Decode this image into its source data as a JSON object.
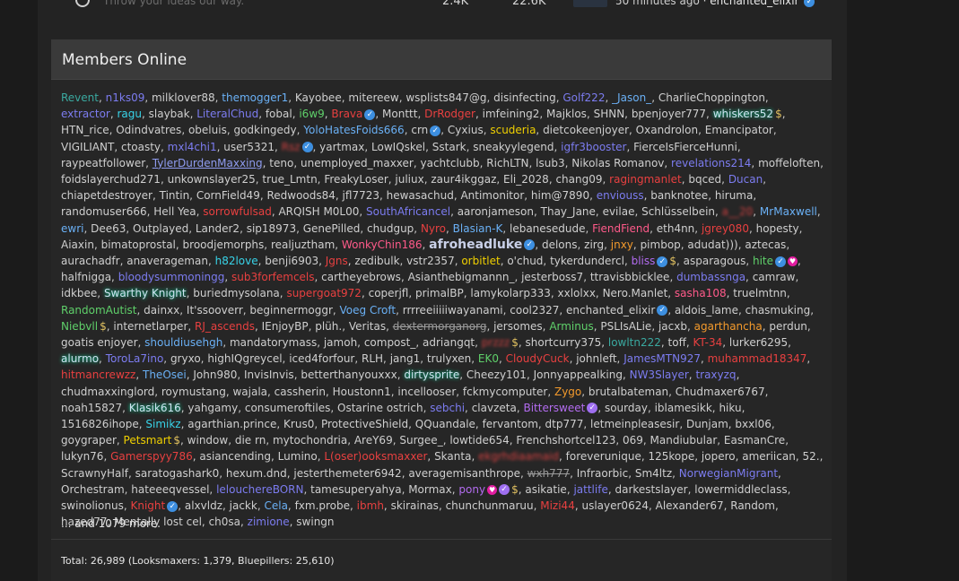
{
  "top_row": {
    "description": "Throw your ideas our way.",
    "threads": "2.4K",
    "posts": "22.6K",
    "time": "50 minutes ago",
    "separator": " · ",
    "user": "enchanted_elixir"
  },
  "widget": {
    "title": "Members Online",
    "more": "... and 1079 more.",
    "total": "Total: 26,989 (Looksmaxers: 1,379, Bluepillers: 25,610)"
  },
  "members": [
    {
      "n": "Revent",
      "s": "teal"
    },
    {
      "n": "n1ks09",
      "s": "indigo"
    },
    {
      "n": "milklover88",
      "s": "white"
    },
    {
      "n": "themogger1",
      "s": "lblue"
    },
    {
      "n": "Kayobee",
      "s": "white"
    },
    {
      "n": "mitereew",
      "s": "white"
    },
    {
      "n": "wsplists847@g",
      "s": "white"
    },
    {
      "n": "disinfecting",
      "s": "white"
    },
    {
      "n": "Golf222",
      "s": "indigo"
    },
    {
      "n": "_Jason_",
      "s": "lblue"
    },
    {
      "n": "CharlieChoppington",
      "s": "white"
    },
    {
      "n": "extractor",
      "s": "indigo"
    },
    {
      "n": "ragu",
      "s": "cyan"
    },
    {
      "n": "slaybak",
      "s": "white"
    },
    {
      "n": "LiteralChud",
      "s": "indigo"
    },
    {
      "n": "fobal",
      "s": "white"
    },
    {
      "n": "i6w9",
      "s": "green"
    },
    {
      "n": "Brava",
      "s": "red",
      "v": true
    },
    {
      "n": "Monttt",
      "s": "white"
    },
    {
      "n": "DrRodger",
      "s": "red"
    },
    {
      "n": "imfeining2",
      "s": "white"
    },
    {
      "n": "Majklos",
      "s": "white"
    },
    {
      "n": "SHNN",
      "s": "white"
    },
    {
      "n": "bpenjoyer777",
      "s": "white"
    },
    {
      "n": "whiskers52",
      "s": "glow",
      "d": true
    },
    {
      "n": "HTN_rice",
      "s": "white"
    },
    {
      "n": "Odindvatres",
      "s": "white"
    },
    {
      "n": "obeluis",
      "s": "white"
    },
    {
      "n": "godkingedy",
      "s": "white"
    },
    {
      "n": "YoloHatesFoids666",
      "s": "lblue"
    },
    {
      "n": "crn",
      "s": "white",
      "v": true
    },
    {
      "n": "Cyxius",
      "s": "white"
    },
    {
      "n": "scuderia",
      "s": "yellow"
    },
    {
      "n": "dietcokeenjoyer",
      "s": "white"
    },
    {
      "n": "Oxandrolon",
      "s": "white"
    },
    {
      "n": "Emancipator",
      "s": "white"
    },
    {
      "n": "VIGILIANT",
      "s": "white"
    },
    {
      "n": "ctoasty",
      "s": "white"
    },
    {
      "n": "mxl4chi1",
      "s": "indigo"
    },
    {
      "n": "user5321",
      "s": "white"
    },
    {
      "n": "Rsz",
      "s": "blur",
      "v": true
    },
    {
      "n": "yartmax",
      "s": "white"
    },
    {
      "n": "LowIQskel",
      "s": "white"
    },
    {
      "n": "Sstark",
      "s": "white"
    },
    {
      "n": "sneakyylegend",
      "s": "white"
    },
    {
      "n": "igfr3booster",
      "s": "indigo"
    },
    {
      "n": "FierceIsFierceHunni",
      "s": "white"
    },
    {
      "n": "raypeatfollower",
      "s": "white"
    },
    {
      "n": "TylerDurdenMaxxing",
      "s": "under"
    },
    {
      "n": "teno",
      "s": "white"
    },
    {
      "n": "unemployed_maxxer",
      "s": "white"
    },
    {
      "n": "yachtclubb",
      "s": "white"
    },
    {
      "n": "RichLTN",
      "s": "white"
    },
    {
      "n": "lsub3",
      "s": "white"
    },
    {
      "n": "Nikolas Romanov",
      "s": "white"
    },
    {
      "n": "revelations214",
      "s": "indigo"
    },
    {
      "n": "moffeloften",
      "s": "white"
    },
    {
      "n": "foidslayerchud271",
      "s": "white"
    },
    {
      "n": "unkownslayer25",
      "s": "white"
    },
    {
      "n": "true_Lmtn",
      "s": "white"
    },
    {
      "n": "FreakyLoser",
      "s": "white"
    },
    {
      "n": "juliux",
      "s": "white"
    },
    {
      "n": "zaur4ikggaz",
      "s": "white"
    },
    {
      "n": "Eli_2028",
      "s": "white"
    },
    {
      "n": "chang09",
      "s": "white"
    },
    {
      "n": "ragingmanlet",
      "s": "red"
    },
    {
      "n": "bqced",
      "s": "white"
    },
    {
      "n": "Ducan",
      "s": "indigo"
    },
    {
      "n": "chiapetdestroyer",
      "s": "white"
    },
    {
      "n": "Tintin",
      "s": "white"
    },
    {
      "n": "CornField49",
      "s": "white"
    },
    {
      "n": "Redwoods84",
      "s": "white"
    },
    {
      "n": "jfl7723",
      "s": "white"
    },
    {
      "n": "hewasachud",
      "s": "white"
    },
    {
      "n": "Antimonitor",
      "s": "white"
    },
    {
      "n": "him@7890",
      "s": "white"
    },
    {
      "n": "enviouss",
      "s": "indigo"
    },
    {
      "n": "banknotee",
      "s": "white"
    },
    {
      "n": "hiruma",
      "s": "white"
    },
    {
      "n": "randomuser666",
      "s": "white"
    },
    {
      "n": "Hell Yea",
      "s": "white"
    },
    {
      "n": "sorrowfulsad",
      "s": "red"
    },
    {
      "n": "ARQISH M0L00",
      "s": "white"
    },
    {
      "n": "SouthAfricancel",
      "s": "indigo"
    },
    {
      "n": "aaronjameson",
      "s": "white"
    },
    {
      "n": "Thay_Jane",
      "s": "white"
    },
    {
      "n": "evilae",
      "s": "white"
    },
    {
      "n": "Schlüsselbein",
      "s": "white"
    },
    {
      "n": "a__20",
      "s": "blur"
    },
    {
      "n": "MrMaxwell",
      "s": "lblue"
    },
    {
      "n": "ewri",
      "s": "lblue"
    },
    {
      "n": "Dee63",
      "s": "white"
    },
    {
      "n": "Outplayed",
      "s": "white"
    },
    {
      "n": "Lander2",
      "s": "white"
    },
    {
      "n": "sip18973",
      "s": "white"
    },
    {
      "n": "GenePilled",
      "s": "white"
    },
    {
      "n": "chudgup",
      "s": "white"
    },
    {
      "n": "Nyro",
      "s": "red"
    },
    {
      "n": "Blasian-K",
      "s": "lblue"
    },
    {
      "n": "lebanesedude",
      "s": "white"
    },
    {
      "n": "FiendFiend",
      "s": "pink"
    },
    {
      "n": "eth4nn",
      "s": "white"
    },
    {
      "n": "jgrey080",
      "s": "red"
    },
    {
      "n": "hopesty",
      "s": "white"
    },
    {
      "n": "Aiaxin",
      "s": "white"
    },
    {
      "n": "bimatoprostal",
      "s": "white"
    },
    {
      "n": "broodjemorphs",
      "s": "white"
    },
    {
      "n": "realjuztham",
      "s": "white"
    },
    {
      "n": "WonkyChin186",
      "s": "pink"
    },
    {
      "n": "afroheadluke",
      "s": "bold",
      "v": true
    },
    {
      "n": "delons",
      "s": "white"
    },
    {
      "n": "zirg",
      "s": "white"
    },
    {
      "n": "jnxy",
      "s": "orange"
    },
    {
      "n": "pimbop",
      "s": "white"
    },
    {
      "n": "adudat)))",
      "s": "white"
    },
    {
      "n": "aztecas",
      "s": "white"
    },
    {
      "n": "aurachadfr",
      "s": "white"
    },
    {
      "n": "anaverageman",
      "s": "white"
    },
    {
      "n": "h82love",
      "s": "cyan"
    },
    {
      "n": "benji6903",
      "s": "white"
    },
    {
      "n": "Jgns",
      "s": "red"
    },
    {
      "n": "zedibulk",
      "s": "white"
    },
    {
      "n": "vstr2357",
      "s": "white"
    },
    {
      "n": "orbitlet",
      "s": "yellow"
    },
    {
      "n": "o'chud",
      "s": "white"
    },
    {
      "n": "tykerdundercl",
      "s": "white"
    },
    {
      "n": "bliss",
      "s": "purple",
      "v": true,
      "d": true
    },
    {
      "n": "asparagous",
      "s": "white"
    },
    {
      "n": "hite",
      "s": "green",
      "v": true,
      "h": true
    },
    {
      "n": "halfnigga",
      "s": "white"
    },
    {
      "n": "bloodysummoningg",
      "s": "indigo"
    },
    {
      "n": "sub3forfemcels",
      "s": "red"
    },
    {
      "n": "cartheyebrows",
      "s": "white"
    },
    {
      "n": "Asianthebigmannn_",
      "s": "white"
    },
    {
      "n": "jesterboss7",
      "s": "white"
    },
    {
      "n": "ttravisbbicklee",
      "s": "white"
    },
    {
      "n": "dumbassnga",
      "s": "indigo"
    },
    {
      "n": "camraw",
      "s": "white"
    },
    {
      "n": "idkbee",
      "s": "white"
    },
    {
      "n": "Swarthy Knight",
      "s": "glow"
    },
    {
      "n": "buriedmysolana",
      "s": "white"
    },
    {
      "n": "supergoat972",
      "s": "red"
    },
    {
      "n": "coperjfl",
      "s": "white"
    },
    {
      "n": "primalBP",
      "s": "white"
    },
    {
      "n": "lamykolarp333",
      "s": "white"
    },
    {
      "n": "xxlolxx",
      "s": "white"
    },
    {
      "n": "Nero.Manlet",
      "s": "white"
    },
    {
      "n": "sasha108",
      "s": "pink"
    },
    {
      "n": "truelmtnn",
      "s": "white"
    },
    {
      "n": "RandomAutist",
      "s": "green"
    },
    {
      "n": "dainxx",
      "s": "white"
    },
    {
      "n": "It'ssooverr",
      "s": "white"
    },
    {
      "n": "beginnermoggr",
      "s": "white"
    },
    {
      "n": "Voeg Croft",
      "s": "lblue"
    },
    {
      "n": "rrrreeiiiiiwayanami",
      "s": "white"
    },
    {
      "n": "cool2327",
      "s": "white"
    },
    {
      "n": "enchanted_elixir",
      "s": "white",
      "v": true
    },
    {
      "n": "aldois_lame",
      "s": "white"
    },
    {
      "n": "chasmuking",
      "s": "white"
    },
    {
      "n": "Niebvll",
      "s": "green",
      "d": true
    },
    {
      "n": "internetlarper",
      "s": "white"
    },
    {
      "n": "RJ_ascends",
      "s": "red"
    },
    {
      "n": "IEnjoyBP",
      "s": "white"
    },
    {
      "n": "plüh.",
      "s": "white"
    },
    {
      "n": "Veritas",
      "s": "white"
    },
    {
      "n": "dextermorganorg",
      "s": "strike"
    },
    {
      "n": "jersomes",
      "s": "white"
    },
    {
      "n": "Arminus",
      "s": "green"
    },
    {
      "n": "PSLIsALie",
      "s": "white"
    },
    {
      "n": "jacxb",
      "s": "white"
    },
    {
      "n": "agarthancha",
      "s": "orange"
    },
    {
      "n": "perdun",
      "s": "white"
    },
    {
      "n": "goatis enjoyer",
      "s": "white"
    },
    {
      "n": "shouldiusehgh",
      "s": "lblue"
    },
    {
      "n": "mandatorymass",
      "s": "white"
    },
    {
      "n": "jamoh",
      "s": "white"
    },
    {
      "n": "compost_",
      "s": "white"
    },
    {
      "n": "adriangqt",
      "s": "white"
    },
    {
      "n": "przzz",
      "s": "blur",
      "d": true
    },
    {
      "n": "shortcurry375",
      "s": "white"
    },
    {
      "n": "lowltn222",
      "s": "teal"
    },
    {
      "n": "toff",
      "s": "white"
    },
    {
      "n": "KT-34",
      "s": "red"
    },
    {
      "n": "lurker6295",
      "s": "white"
    },
    {
      "n": "alurmo",
      "s": "glow"
    },
    {
      "n": "ToroLa7ino",
      "s": "indigo"
    },
    {
      "n": "gryxo",
      "s": "white"
    },
    {
      "n": "highIQgreycel",
      "s": "white"
    },
    {
      "n": "iced4forfour",
      "s": "white"
    },
    {
      "n": "RLH",
      "s": "white"
    },
    {
      "n": "jang1",
      "s": "white"
    },
    {
      "n": "trulyxen",
      "s": "white"
    },
    {
      "n": "EK0",
      "s": "green"
    },
    {
      "n": "CloudyCuck",
      "s": "red"
    },
    {
      "n": "johnleft",
      "s": "white"
    },
    {
      "n": "JamesMTN927",
      "s": "indigo"
    },
    {
      "n": "muhammad18347",
      "s": "red"
    },
    {
      "n": "hitmancrewzz",
      "s": "red"
    },
    {
      "n": "TheOsei",
      "s": "lblue"
    },
    {
      "n": "John980",
      "s": "white"
    },
    {
      "n": "InvisInvis",
      "s": "white"
    },
    {
      "n": "betterthanyouxxx",
      "s": "white"
    },
    {
      "n": "dirtysprite",
      "s": "glow"
    },
    {
      "n": "Cheezy101",
      "s": "white"
    },
    {
      "n": "Jonnyappealking",
      "s": "white"
    },
    {
      "n": "NW3Slayer",
      "s": "indigo"
    },
    {
      "n": "traxyzq",
      "s": "indigo"
    },
    {
      "n": "chudmaxxinglord",
      "s": "white"
    },
    {
      "n": "roymustang",
      "s": "white"
    },
    {
      "n": "wajala",
      "s": "white"
    },
    {
      "n": "cassherin",
      "s": "white"
    },
    {
      "n": "Houstonn1",
      "s": "white"
    },
    {
      "n": "incellooser",
      "s": "white"
    },
    {
      "n": "fckmycomputer",
      "s": "white"
    },
    {
      "n": "Zygo",
      "s": "orange"
    },
    {
      "n": "brutalbateman",
      "s": "white"
    },
    {
      "n": "Chudmaxer6767",
      "s": "white"
    },
    {
      "n": "noah15827",
      "s": "white"
    },
    {
      "n": "Klasik616",
      "s": "glow"
    },
    {
      "n": "yahgamy",
      "s": "white"
    },
    {
      "n": "consumeroftiles",
      "s": "white"
    },
    {
      "n": "Ostarine ostrich",
      "s": "white"
    },
    {
      "n": "sebchi",
      "s": "indigo"
    },
    {
      "n": "clavzeta",
      "s": "white"
    },
    {
      "n": "Bittersweet",
      "s": "purple",
      "p": true
    },
    {
      "n": "sourday",
      "s": "white"
    },
    {
      "n": "iblamesikk",
      "s": "white"
    },
    {
      "n": "hiku",
      "s": "white"
    },
    {
      "n": "1516826ihope",
      "s": "white"
    },
    {
      "n": "Simikz",
      "s": "cyan"
    },
    {
      "n": "agarthian.prince",
      "s": "white"
    },
    {
      "n": "Krus0",
      "s": "white"
    },
    {
      "n": "ProtectiveShield",
      "s": "white"
    },
    {
      "n": "QQuandale",
      "s": "white"
    },
    {
      "n": "fervantom",
      "s": "white"
    },
    {
      "n": "dtp777",
      "s": "white"
    },
    {
      "n": "letmeinpleasesir",
      "s": "white"
    },
    {
      "n": "Dunjam",
      "s": "white"
    },
    {
      "n": "bxxl06",
      "s": "white"
    },
    {
      "n": "goygraper",
      "s": "white"
    },
    {
      "n": "Petsmart",
      "s": "yellow",
      "d": true
    },
    {
      "n": "window",
      "s": "white"
    },
    {
      "n": "die rn",
      "s": "white"
    },
    {
      "n": "mytochondria",
      "s": "white"
    },
    {
      "n": "AreY69",
      "s": "white"
    },
    {
      "n": "Surgee_",
      "s": "white"
    },
    {
      "n": "lowtide654",
      "s": "white"
    },
    {
      "n": "Frenchshortcel123",
      "s": "white"
    },
    {
      "n": "069",
      "s": "white"
    },
    {
      "n": "Mandiubular",
      "s": "white"
    },
    {
      "n": "EasmanCre",
      "s": "white"
    },
    {
      "n": "lukyn76",
      "s": "white"
    },
    {
      "n": "Gamerspyy786",
      "s": "red"
    },
    {
      "n": "asiancending",
      "s": "white"
    },
    {
      "n": "Lumino",
      "s": "white"
    },
    {
      "n": "L(oser)ooksmaxxer",
      "s": "red"
    },
    {
      "n": "Skanta",
      "s": "white"
    },
    {
      "n": "ekgrhdiaamaid",
      "s": "blur"
    },
    {
      "n": "foreverunique",
      "s": "white"
    },
    {
      "n": "125kope",
      "s": "white"
    },
    {
      "n": "jopero",
      "s": "white"
    },
    {
      "n": "ameriican",
      "s": "white"
    },
    {
      "n": "52.",
      "s": "white"
    },
    {
      "n": "ScrawnyHalf",
      "s": "white"
    },
    {
      "n": "saratogashark0",
      "s": "white"
    },
    {
      "n": "hexum.dnd",
      "s": "white"
    },
    {
      "n": "jesterthemeter6942",
      "s": "white"
    },
    {
      "n": "averagemisanthrope",
      "s": "white"
    },
    {
      "n": "wxh777",
      "s": "strike"
    },
    {
      "n": "Infraorbic",
      "s": "white"
    },
    {
      "n": "Sm4ltz",
      "s": "white"
    },
    {
      "n": "NorwegianMigrant",
      "s": "indigo"
    },
    {
      "n": "Orchestram",
      "s": "white"
    },
    {
      "n": "hateeeqvessel",
      "s": "white"
    },
    {
      "n": "lelouchereBORN",
      "s": "indigo"
    },
    {
      "n": "tamesuperyahya",
      "s": "white"
    },
    {
      "n": "Mormax",
      "s": "white"
    },
    {
      "n": "pony",
      "s": "purple",
      "h": true,
      "p": true,
      "d": true
    },
    {
      "n": "asikatie",
      "s": "white"
    },
    {
      "n": "jattlife",
      "s": "indigo"
    },
    {
      "n": "darkestslayer",
      "s": "white"
    },
    {
      "n": "lowermiddleclass",
      "s": "white"
    },
    {
      "n": "swinolionus",
      "s": "white"
    },
    {
      "n": "Knight",
      "s": "red",
      "v": true
    },
    {
      "n": "alxvldz",
      "s": "white"
    },
    {
      "n": "jackk",
      "s": "white"
    },
    {
      "n": "Cela",
      "s": "lblue"
    },
    {
      "n": "fxm.probe",
      "s": "white"
    },
    {
      "n": "ibmh",
      "s": "red"
    },
    {
      "n": "skirainas",
      "s": "white"
    },
    {
      "n": "chunchunmaruu",
      "s": "white"
    },
    {
      "n": "Mizi44",
      "s": "red"
    },
    {
      "n": "uslayer0624",
      "s": "white"
    },
    {
      "n": "Alexander67",
      "s": "white"
    },
    {
      "n": "Random",
      "s": "white"
    },
    {
      "n": "hazed77",
      "s": "white"
    },
    {
      "n": "Mentally lost cel",
      "s": "white"
    },
    {
      "n": "ch0sa",
      "s": "white"
    },
    {
      "n": "zimione",
      "s": "indigo"
    },
    {
      "n": "swingn",
      "s": "white"
    }
  ],
  "icons": {
    "verified": "verified-check-icon",
    "dollar": "dollar-badge-icon",
    "heart": "heart-badge-icon",
    "purple_check": "purple-check-icon"
  }
}
